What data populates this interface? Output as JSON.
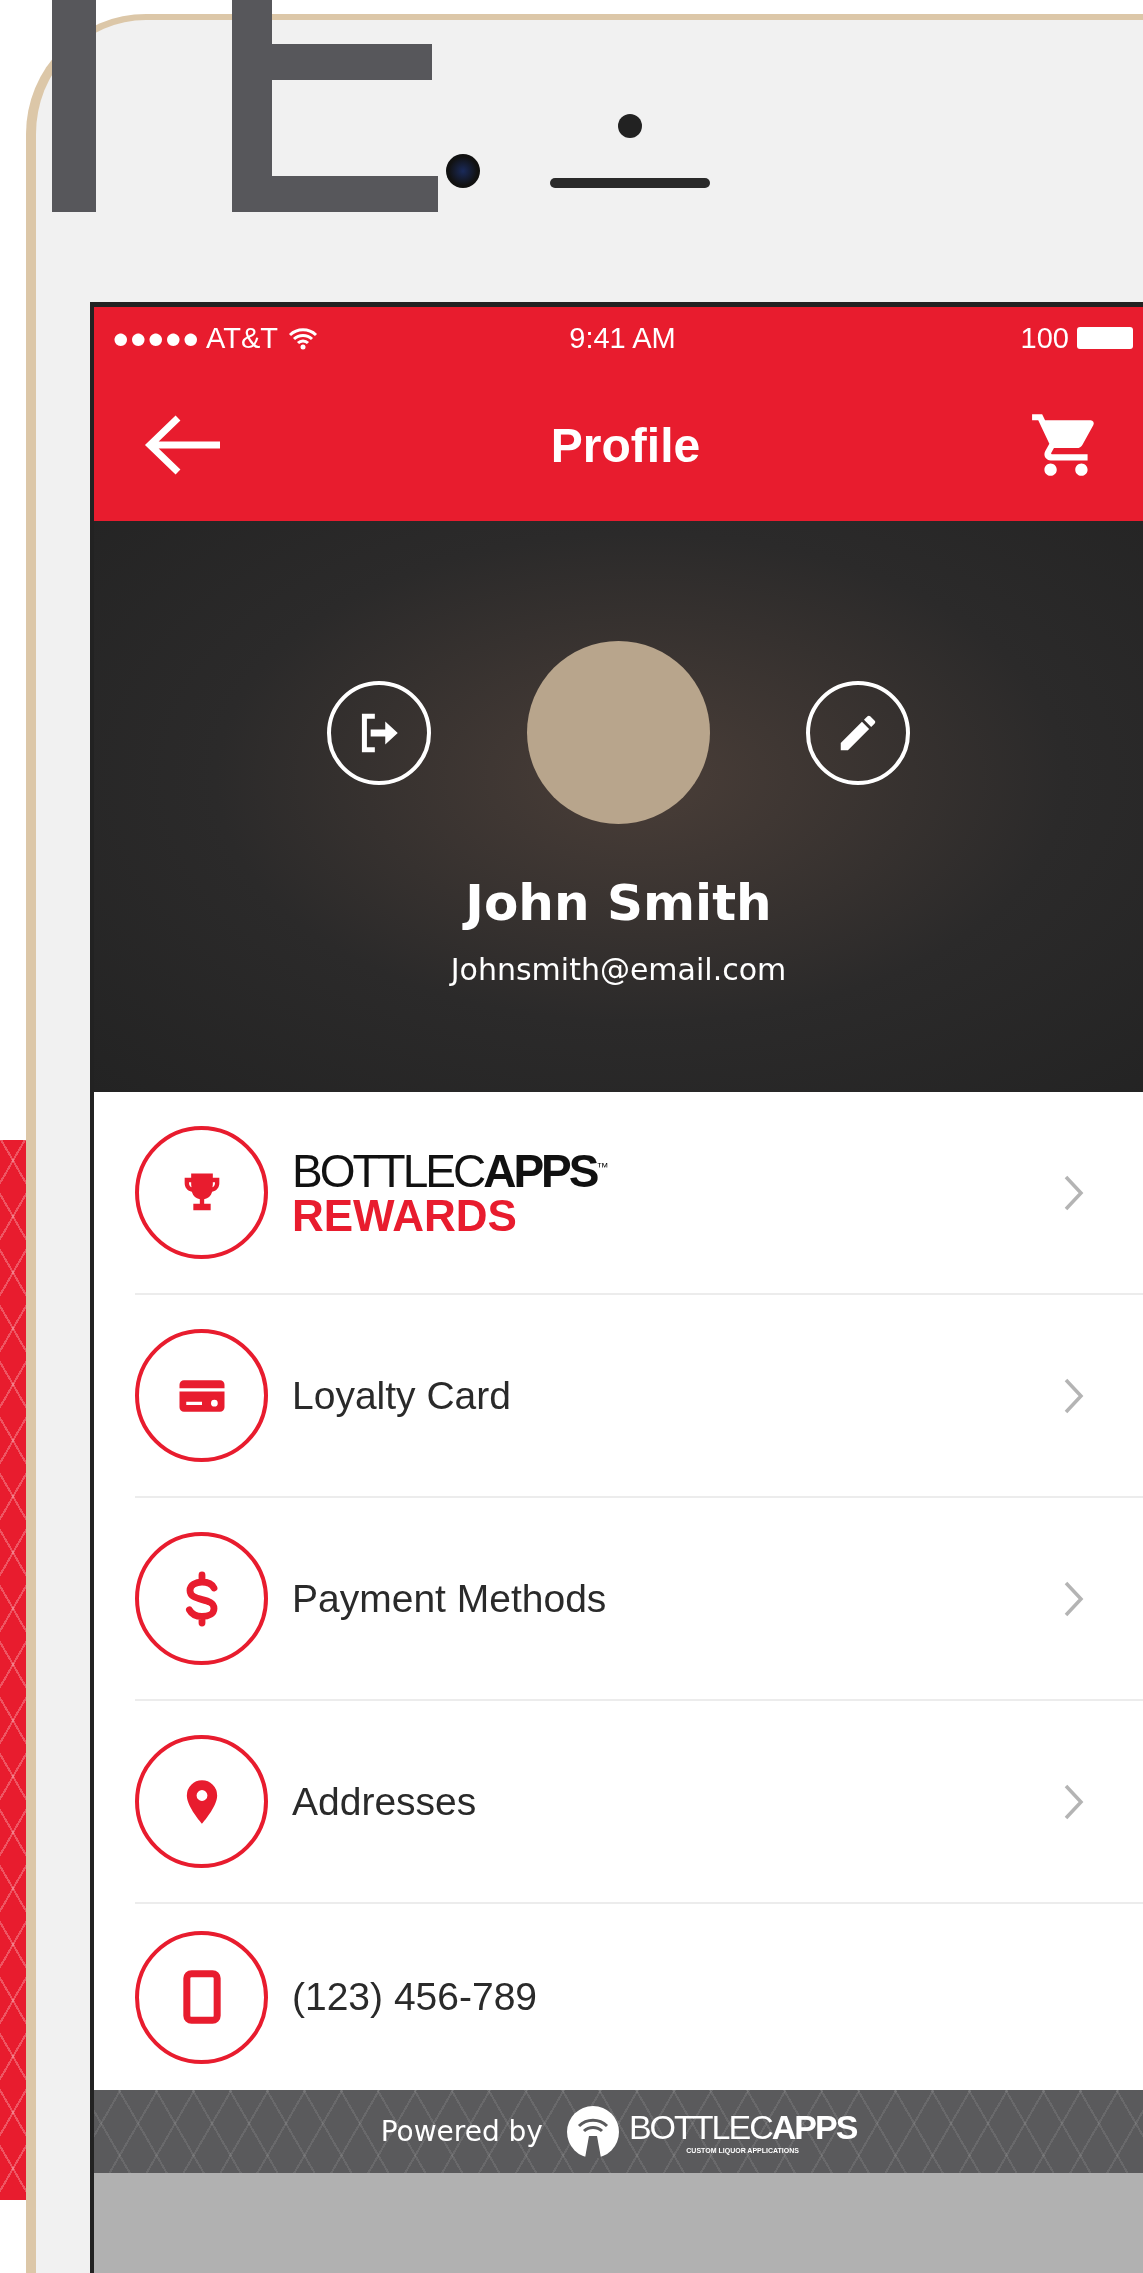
{
  "status_bar": {
    "carrier": "●●●●● AT&T",
    "time": "9:41 AM",
    "battery": "100"
  },
  "header": {
    "title": "Profile"
  },
  "profile": {
    "name": "John Smith",
    "email": "Johnsmith@email.com"
  },
  "menu": [
    {
      "kind": "logo",
      "brand": "BOTTLEC**APPS**$^{™}$",
      "label": "REWARDS",
      "chevron": true
    },
    {
      "kind": "text",
      "label": "Loyalty Card",
      "chevron": true
    },
    {
      "kind": "text",
      "label": "Payment Methods",
      "chevron": true
    },
    {
      "kind": "text",
      "label": "Addresses",
      "chevron": true
    },
    {
      "kind": "text",
      "label": "(123) 456-789",
      "chevron": false
    }
  ],
  "footer": {
    "powered_by": "Powered by",
    "brand": "BOTTLEC**APPS**",
    "tagline": "CUSTOM LIQUOR APPLICATIONS"
  }
}
